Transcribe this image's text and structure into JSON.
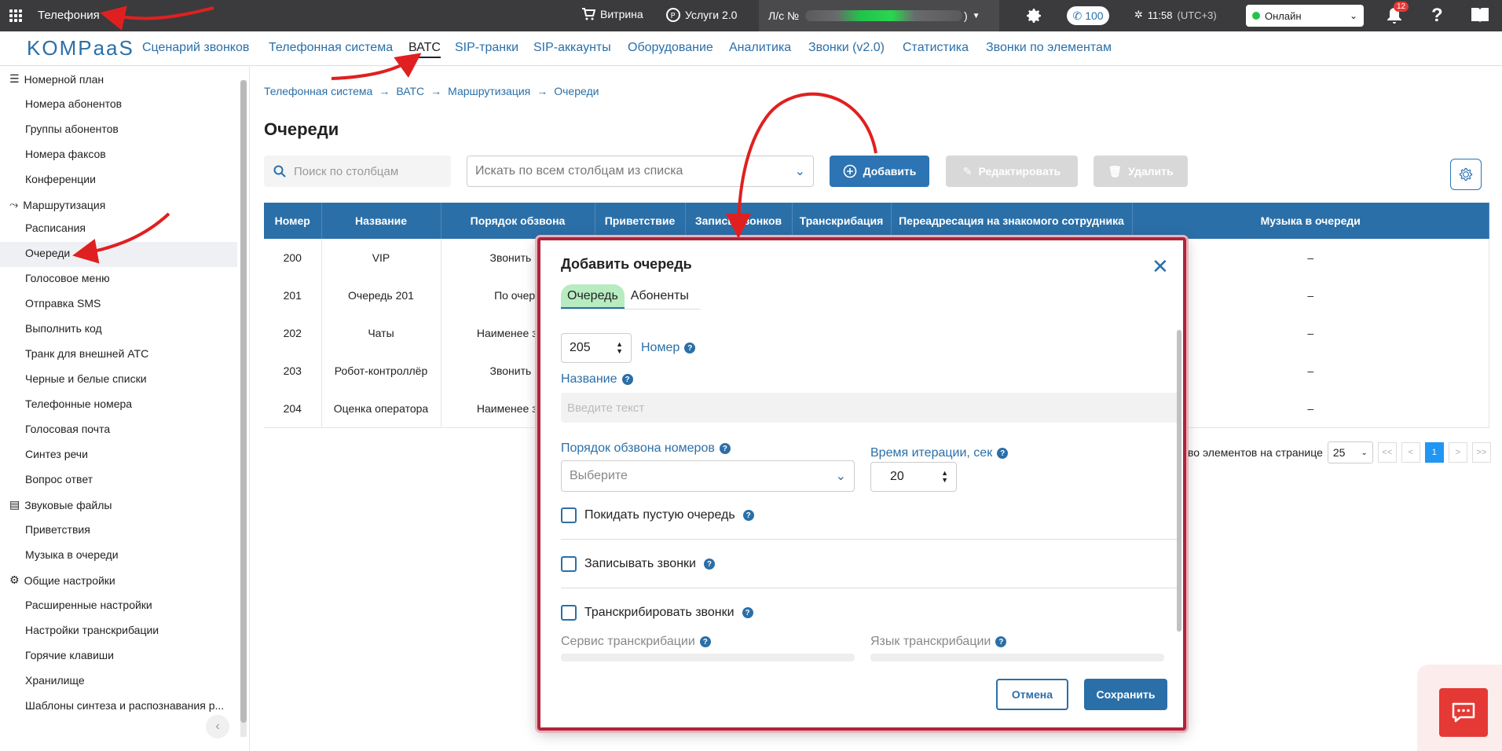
{
  "topbar": {
    "title": "Телефония",
    "vitrina": "Витрина",
    "services": "Услуги 2.0",
    "account_prefix": "Л/с №",
    "account_suffix": ")",
    "calls": "100",
    "time": "11:58",
    "tz": "(UTC+3)",
    "status": "Онлайн",
    "notifications": "12"
  },
  "nav": {
    "logo": "KOMPaaS",
    "items": [
      "Сценарий звонков",
      "Телефонная система",
      "ВАТС",
      "SIP-транки",
      "SIP-аккаунты",
      "Оборудование",
      "Аналитика",
      "Звонки (v2.0)",
      "Статистика",
      "Звонки по элементам"
    ]
  },
  "sidebar": {
    "groups": [
      {
        "label": "Номерной план",
        "items": [
          "Номера абонентов",
          "Группы абонентов",
          "Номера факсов",
          "Конференции"
        ]
      },
      {
        "label": "Маршрутизация",
        "items": [
          "Расписания",
          "Очереди",
          "Голосовое меню",
          "Отправка SMS",
          "Выполнить код",
          "Транк для внешней АТС",
          "Черные и белые списки",
          "Телефонные номера",
          "Голосовая почта",
          "Синтез речи",
          "Вопрос ответ"
        ]
      },
      {
        "label": "Звуковые файлы",
        "items": [
          "Приветствия",
          "Музыка в очереди"
        ]
      },
      {
        "label": "Общие настройки",
        "items": [
          "Расширенные настройки",
          "Настройки транскрибации",
          "Горячие клавиши",
          "Хранилище",
          "Шаблоны синтеза и распознавания р..."
        ]
      }
    ],
    "active": "Очереди"
  },
  "breadcrumbs": [
    "Телефонная система",
    "ВАТС",
    "Маршрутизация",
    "Очереди"
  ],
  "page": {
    "title": "Очереди",
    "search_placeholder": "Поиск по столбцам",
    "column_select": "Искать по всем столбцам из списка",
    "add": "Добавить",
    "edit": "Редактировать",
    "delete": "Удалить"
  },
  "table": {
    "headers": [
      "Номер",
      "Название",
      "Порядок обзвона",
      "Приветствие",
      "Запись звонков",
      "Транскрибация",
      "Переадресация на знакомого сотрудника",
      "Музыка в очереди"
    ],
    "rows": [
      [
        "200",
        "VIP",
        "Звонить вс",
        "",
        "",
        "",
        "",
        "–"
      ],
      [
        "201",
        "Очередь 201",
        "По очере",
        "",
        "",
        "",
        "",
        "–"
      ],
      [
        "202",
        "Чаты",
        "Наименее загру",
        "",
        "",
        "",
        "",
        "–"
      ],
      [
        "203",
        "Робот-контроллёр",
        "Звонить вс",
        "",
        "",
        "",
        "",
        "–"
      ],
      [
        "204",
        "Оценка оператора",
        "Наименее загру",
        "",
        "",
        "",
        "",
        "–"
      ]
    ]
  },
  "pager": {
    "label": "во элементов на странице",
    "per_page": "25",
    "first": "<<",
    "prev": "<",
    "page": "1",
    "next": ">",
    "last": ">>"
  },
  "modal": {
    "title": "Добавить очередь",
    "tabs": [
      "Очередь",
      "Абоненты"
    ],
    "number_value": "205",
    "number_label": "Номер",
    "name_label": "Название",
    "name_placeholder": "Введите текст",
    "order_label": "Порядок обзвона номеров",
    "order_placeholder": "Выберите",
    "iteration_label": "Время итерации, сек",
    "iteration_value": "20",
    "leave_empty": "Покидать пустую очередь",
    "record_calls": "Записывать звонки",
    "transcribe_calls": "Транскрибировать звонки",
    "transcribe_service": "Сервис транскрибации",
    "transcribe_lang": "Язык транскрибации",
    "cancel": "Отмена",
    "save": "Сохранить"
  }
}
